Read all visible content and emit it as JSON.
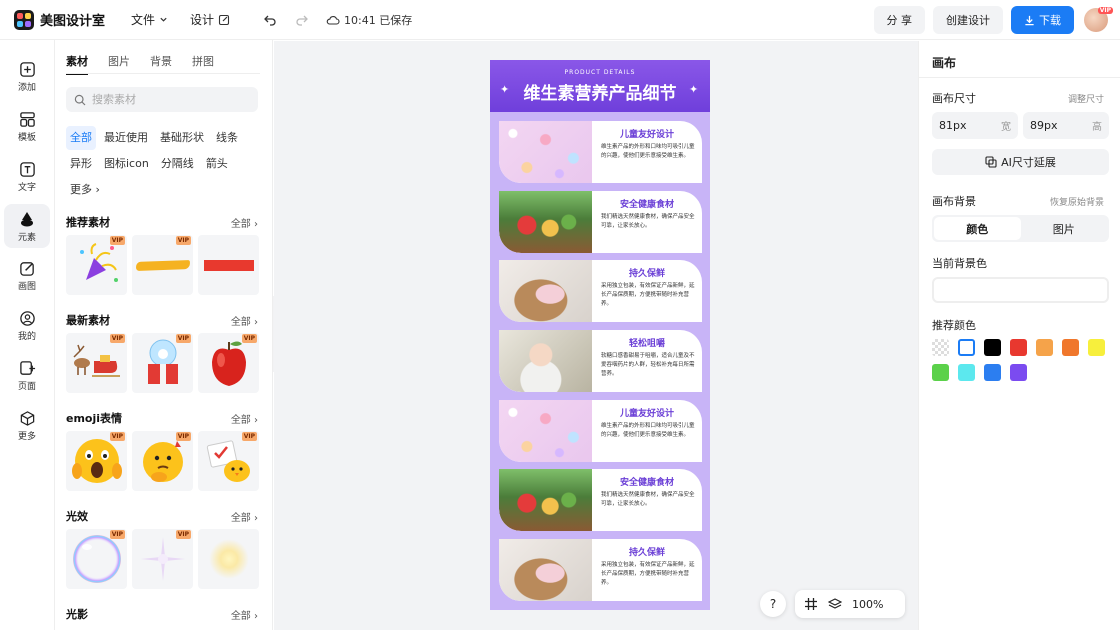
{
  "app": {
    "name": "美图设计室"
  },
  "topbar": {
    "file_menu": "文件",
    "design_menu": "设计",
    "save_status": "10:41 已保存",
    "share": "分 享",
    "create_design": "创建设计",
    "download": "下载"
  },
  "rail": [
    {
      "label": "添加",
      "icon": "plus-square-icon"
    },
    {
      "label": "模板",
      "icon": "template-icon"
    },
    {
      "label": "文字",
      "icon": "text-icon"
    },
    {
      "label": "元素",
      "icon": "shapes-icon"
    },
    {
      "label": "画图",
      "icon": "pencil-icon"
    },
    {
      "label": "我的",
      "icon": "user-icon"
    },
    {
      "label": "页面",
      "icon": "page-icon"
    },
    {
      "label": "更多",
      "icon": "cube-icon"
    }
  ],
  "panel": {
    "tabs": [
      "素材",
      "图片",
      "背景",
      "拼图"
    ],
    "search_placeholder": "搜索素材",
    "chips": [
      "全部",
      "最近使用",
      "基础形状",
      "线条",
      "异形",
      "图标icon",
      "分隔线",
      "箭头",
      "更多"
    ],
    "all_label": "全部",
    "vip": "VIP",
    "sections": [
      "推荐素材",
      "最新素材",
      "emoji表情",
      "光效",
      "光影"
    ]
  },
  "poster": {
    "subtitle": "PRODUCT DETAILS",
    "title": "维生素营养产品细节",
    "cards": [
      {
        "title": "儿童友好设计",
        "body": "维生素产品的外形和口味均可吸引儿童的兴趣，使他们更乐意接受维生素。"
      },
      {
        "title": "安全健康食材",
        "body": "我们精选天然健康食材，确保产品安全可靠，让家长放心。"
      },
      {
        "title": "持久保鲜",
        "body": "采用独立包装，有效保证产品新鲜，延长产品保质期，方便携带随时补充营养。"
      },
      {
        "title": "轻松咀嚼",
        "body": "软糖口感香甜易于咀嚼，适合儿童及不爱吞咽药片的人群，轻松补充每日所需营养。"
      },
      {
        "title": "儿童友好设计",
        "body": "维生素产品的外形和口味均可吸引儿童的兴趣，使他们更乐意接受维生素。"
      },
      {
        "title": "安全健康食材",
        "body": "我们精选天然健康食材，确保产品安全可靠，让家长放心。"
      },
      {
        "title": "持久保鲜",
        "body": "采用独立包装，有效保证产品新鲜，延长产品保质期，方便携带随时补充营养。"
      }
    ]
  },
  "bottom": {
    "help": "?",
    "zoom": "100%"
  },
  "right": {
    "title": "画布",
    "size_label": "画布尺寸",
    "adjust_size": "调整尺寸",
    "width_value": "81px",
    "width_unit": "宽",
    "height_value": "89px",
    "height_unit": "高",
    "ai_extend": "AI尺寸延展",
    "bg_label": "画布背景",
    "restore_bg": "恢复原始背景",
    "seg_color": "颜色",
    "seg_image": "图片",
    "current_bg": "当前背景色",
    "recommended": "推荐颜色",
    "swatches": [
      "transparent",
      "#ffffff",
      "#000000",
      "#e8382f",
      "#f5a34a",
      "#f0772c",
      "#f7ef3c",
      "#5bd14a",
      "#5ce8ee",
      "#2c7ef0",
      "#7b4bf0"
    ]
  }
}
